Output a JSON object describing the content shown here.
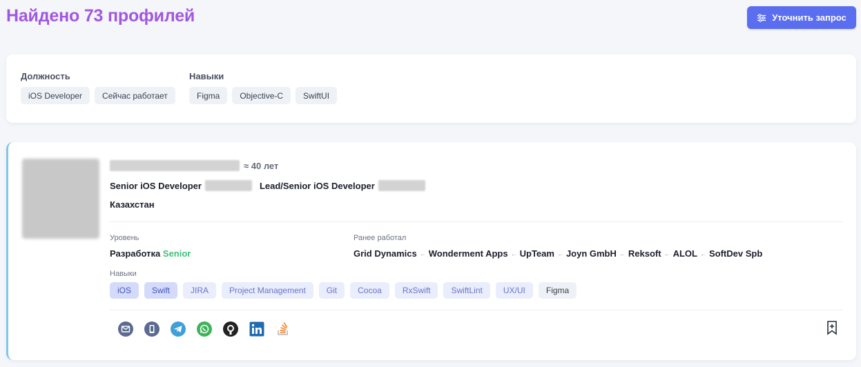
{
  "header": {
    "title": "Найдено 73 профилей",
    "refine_button": "Уточнить запрос"
  },
  "filters": {
    "position": {
      "label": "Должность",
      "chips": [
        "iOS Developer",
        "Сейчас работает"
      ]
    },
    "skills": {
      "label": "Навыки",
      "chips": [
        "Figma",
        "Objective-C",
        "SwiftUI"
      ]
    }
  },
  "profile": {
    "age": "≈ 40 лет",
    "jobs": [
      "Senior iOS Developer",
      "Lead/Senior iOS Developer"
    ],
    "location": "Казахстан",
    "level_label": "Уровень",
    "level_area": "Разработка",
    "level_grade": "Senior",
    "prev_label": "Ранее работал",
    "companies": [
      "Grid Dynamics",
      "Wonderment Apps",
      "UpTeam",
      "Joyn GmbH",
      "Reksoft",
      "ALOL",
      "SoftDev Spb"
    ],
    "skills_label": "Навыки",
    "skills": [
      "iOS",
      "Swift",
      "JIRA",
      "Project Management",
      "Git",
      "Cocoa",
      "RxSwift",
      "SwiftLint",
      "UX/UI",
      "Figma"
    ],
    "contacts": [
      "email-icon",
      "phone-icon",
      "telegram-icon",
      "whatsapp-icon",
      "github-icon",
      "linkedin-icon",
      "stackoverflow-icon"
    ]
  },
  "colors": {
    "title": "#a157e0",
    "accent": "#5b6ef0",
    "senior": "#3dbf7a",
    "card_border": "#7fc7ec"
  }
}
